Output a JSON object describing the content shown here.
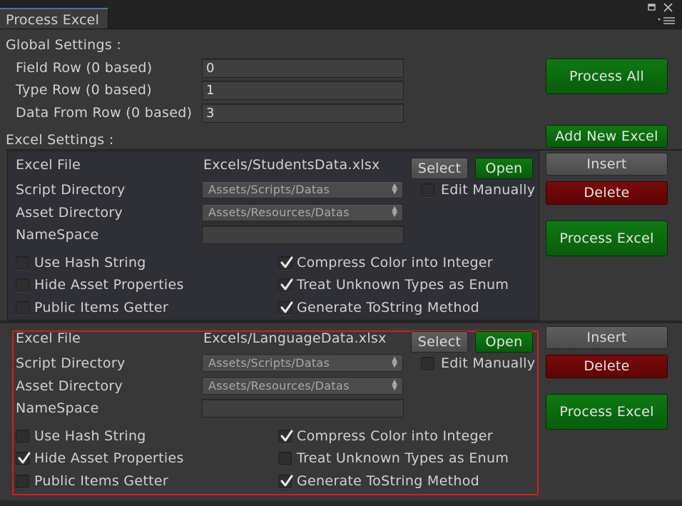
{
  "window": {
    "tab_title": "Process Excel"
  },
  "global": {
    "heading": "Global Settings :",
    "field_row_label": "Field Row (0 based)",
    "field_row_value": "0",
    "type_row_label": "Type Row (0 based)",
    "type_row_value": "1",
    "data_row_label": "Data From Row (0 based)",
    "data_row_value": "3"
  },
  "buttons": {
    "process_all": "Process All",
    "add_new_excel": "Add New Excel"
  },
  "excel_heading": "Excel Settings :",
  "items": [
    {
      "excel_file_label": "Excel File",
      "excel_file_value": "Excels/StudentsData.xlsx",
      "select": "Select",
      "open": "Open",
      "script_dir_label": "Script Directory",
      "script_dir_value": "Assets/Scripts/Datas",
      "asset_dir_label": "Asset Directory",
      "asset_dir_value": "Assets/Resources/Datas",
      "namespace_label": "NameSpace",
      "namespace_value": "",
      "edit_manually": "Edit Manually",
      "use_hash": "Use Hash String",
      "hide_asset": "Hide Asset Properties",
      "public_items": "Public Items Getter",
      "compress_color": "Compress Color into Integer",
      "treat_unknown": "Treat Unknown Types as Enum",
      "gen_tostring": "Generate ToString Method",
      "insert": "Insert",
      "delete": "Delete",
      "process": "Process Excel",
      "checks": {
        "edit_manually": false,
        "use_hash": false,
        "hide_asset": false,
        "public_items": false,
        "compress_color": true,
        "treat_unknown": true,
        "gen_tostring": true
      }
    },
    {
      "excel_file_label": "Excel File",
      "excel_file_value": "Excels/LanguageData.xlsx",
      "select": "Select",
      "open": "Open",
      "script_dir_label": "Script Directory",
      "script_dir_value": "Assets/Scripts/Datas",
      "asset_dir_label": "Asset Directory",
      "asset_dir_value": "Assets/Resources/Datas",
      "namespace_label": "NameSpace",
      "namespace_value": "",
      "edit_manually": "Edit Manually",
      "use_hash": "Use Hash String",
      "hide_asset": "Hide Asset Properties",
      "public_items": "Public Items Getter",
      "compress_color": "Compress Color into Integer",
      "treat_unknown": "Treat Unknown Types as Enum",
      "gen_tostring": "Generate ToString Method",
      "insert": "Insert",
      "delete": "Delete",
      "process": "Process Excel",
      "checks": {
        "edit_manually": false,
        "use_hash": false,
        "hide_asset": true,
        "public_items": false,
        "compress_color": true,
        "treat_unknown": false,
        "gen_tostring": true
      }
    }
  ],
  "colors": {
    "highlight_border": "#d21e1e",
    "green_button": "#0b6e0e",
    "red_button": "#6e0808"
  }
}
